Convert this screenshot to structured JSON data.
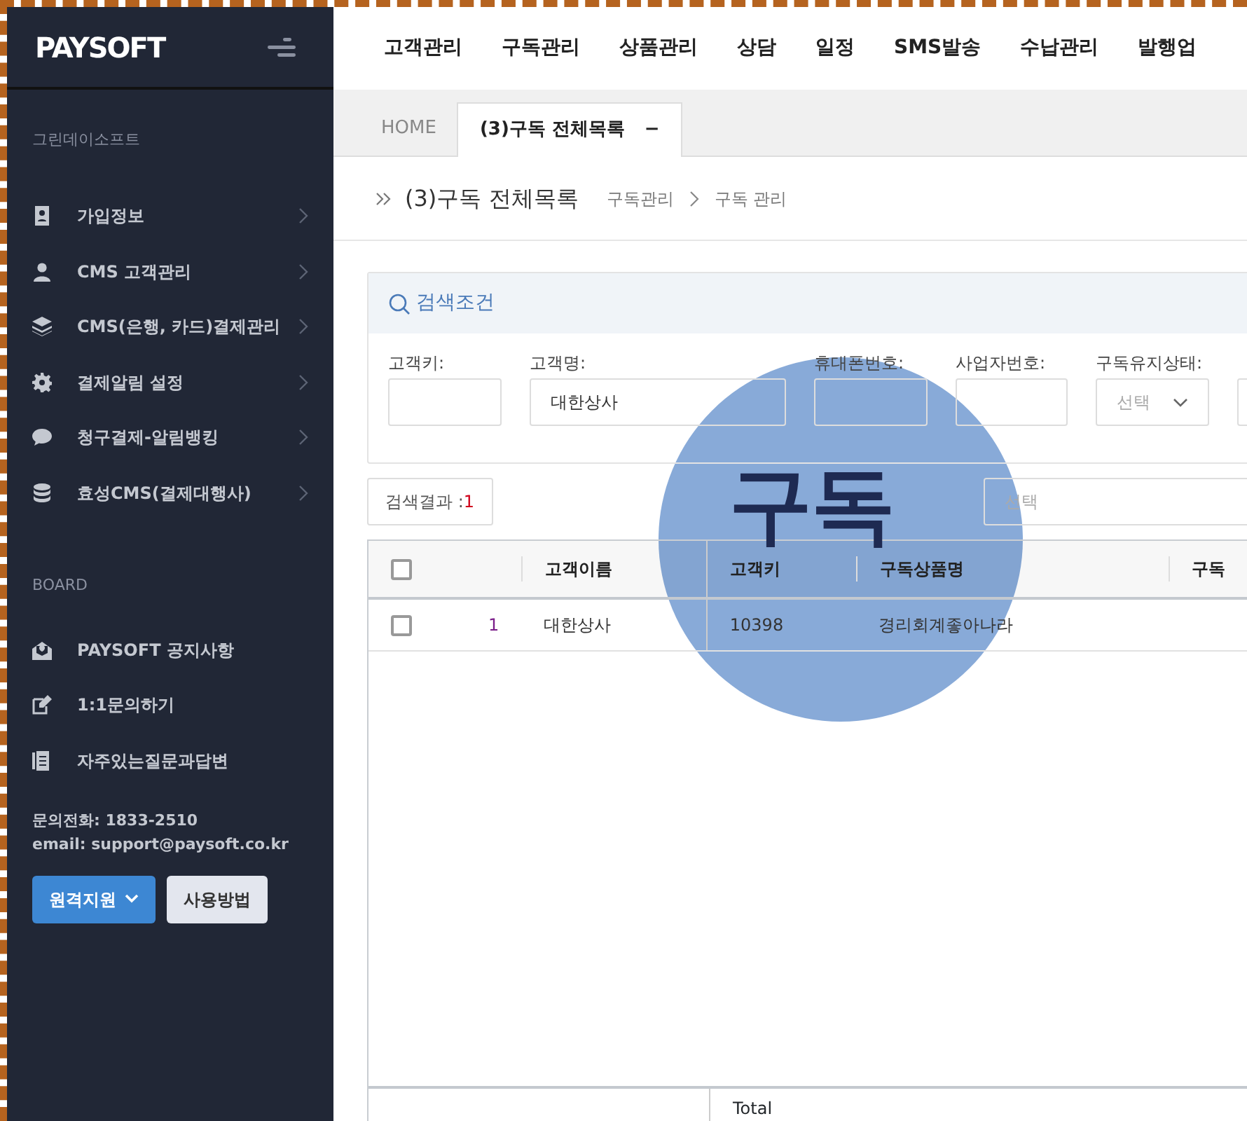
{
  "sidebar": {
    "logo": "PAYSOFT",
    "company": "그린데이소프트",
    "menu": [
      {
        "label": "가입정보"
      },
      {
        "label": "CMS 고객관리"
      },
      {
        "label": "CMS(은행, 카드)결제관리"
      },
      {
        "label": "결제알림 설정"
      },
      {
        "label": "청구결제-알림뱅킹"
      },
      {
        "label": "효성CMS(결제대행사)"
      }
    ],
    "board_title": "BOARD",
    "board": [
      {
        "label": "PAYSOFT 공지사항"
      },
      {
        "label": "1:1문의하기"
      },
      {
        "label": "자주있는질문과답변"
      }
    ],
    "contact": [
      "문의전화: 1833-2510",
      "email: support@paysoft.co.kr"
    ],
    "buttons": [
      {
        "label": "원격지원",
        "kind": "dropdown"
      },
      {
        "label": "사용방법",
        "kind": "plain"
      }
    ]
  },
  "top_nav": [
    "고객관리",
    "구독관리",
    "상품관리",
    "상담",
    "일정",
    "SMS발송",
    "수납관리",
    "발행업"
  ],
  "tabs": [
    {
      "label": "HOME",
      "selected": false
    },
    {
      "label": "(3)구독 전체목록",
      "selected": true,
      "close": "−"
    }
  ],
  "page_header": {
    "title": "(3)구독 전체목록",
    "breadcrumb": [
      "구독관리",
      "구독 관리"
    ]
  },
  "search": {
    "title": "검색조건",
    "fields": [
      {
        "label": "고객키:",
        "kind": "input"
      },
      {
        "label": "고객명:",
        "kind": "input",
        "value": "대한상사"
      },
      {
        "label": "휴대폰번호:",
        "kind": "input"
      },
      {
        "label": "사업자번호:",
        "kind": "input"
      },
      {
        "label": "구독유지상태:",
        "kind": "select",
        "placeholder": "선택"
      },
      {
        "kind": "input"
      }
    ]
  },
  "result": {
    "label": "검색결과 : ",
    "count": "1"
  },
  "sort_select": {
    "placeholder": "선택"
  },
  "table": {
    "header_checked": false,
    "columns": [
      "고객이름",
      "고객키",
      "구독상품명",
      "구독"
    ],
    "rows": [
      {
        "checked": false,
        "number": "1",
        "cells": [
          "대한상사",
          "10398",
          "경리회계좋아나라",
          ""
        ]
      }
    ],
    "footer": "Total"
  },
  "overlay": {
    "text": "구독"
  }
}
